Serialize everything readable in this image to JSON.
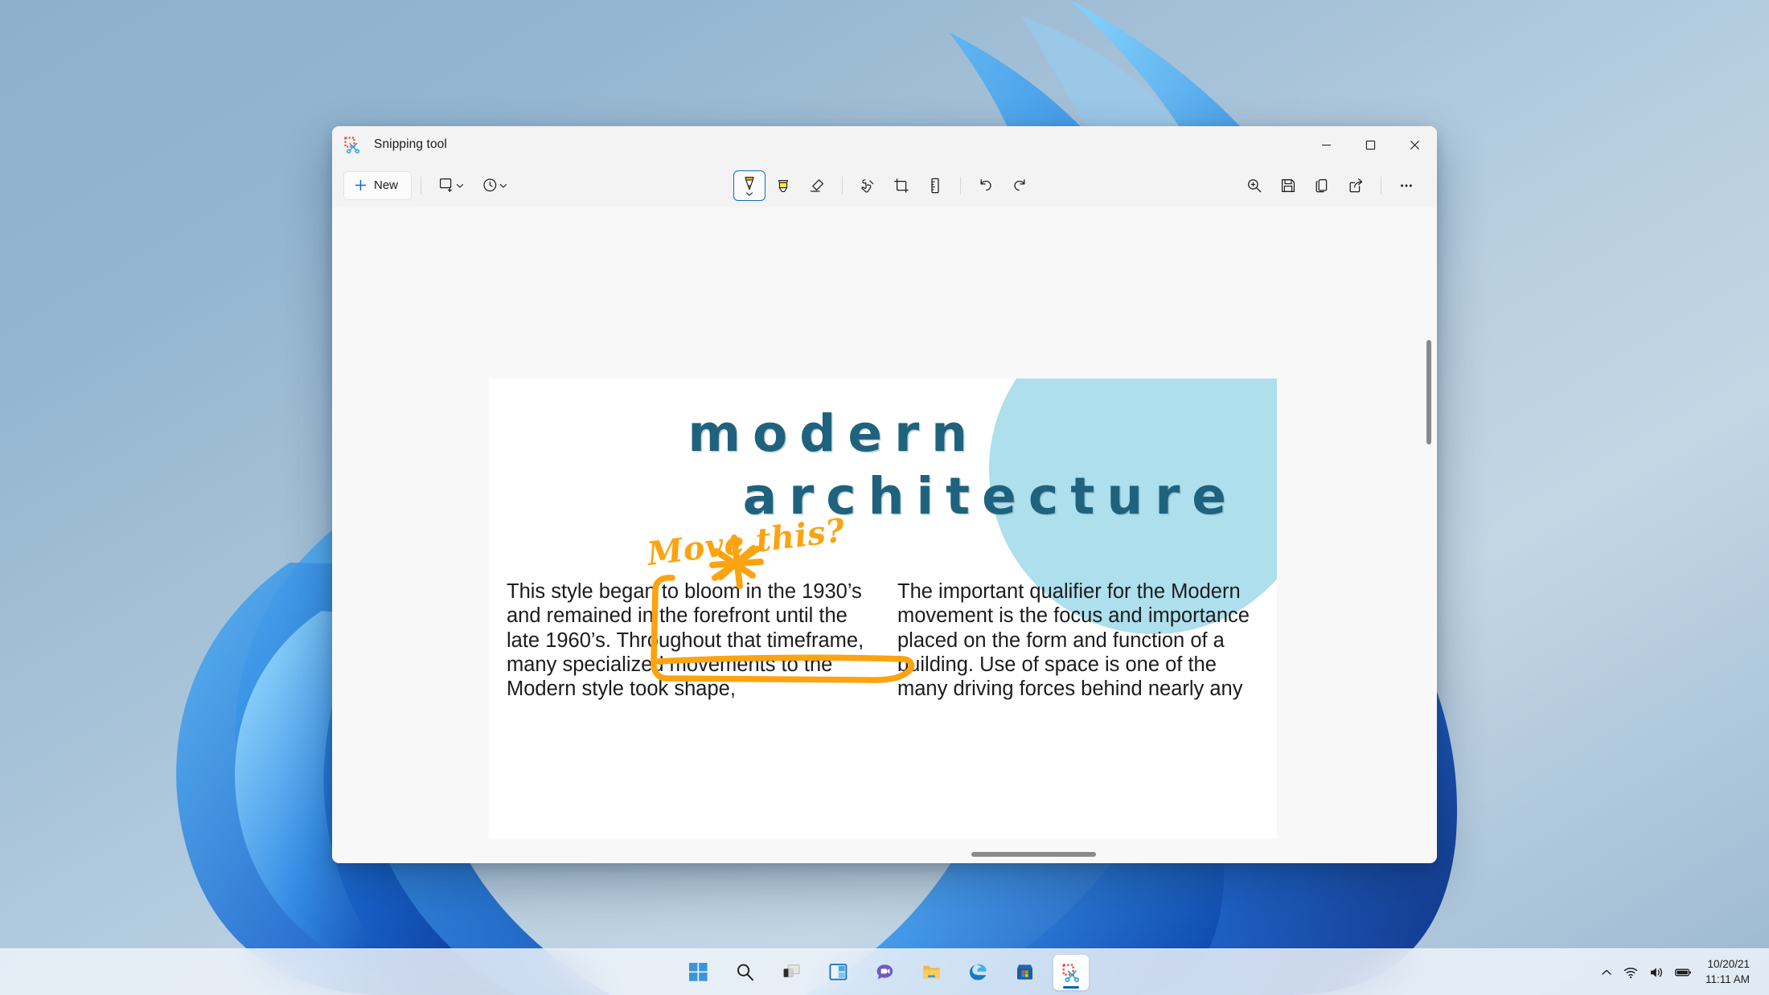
{
  "window": {
    "title": "Snipping tool",
    "app_icon": "snipping-tool-icon",
    "controls": {
      "minimize": "minimize-icon",
      "maximize": "maximize-icon",
      "close": "close-icon"
    }
  },
  "toolbar": {
    "new_label": "New",
    "left_tools": [
      {
        "name": "snip-mode-dropdown",
        "icon": "rectangle-snip-icon"
      },
      {
        "name": "delay-dropdown",
        "icon": "clock-icon"
      }
    ],
    "center_tools": [
      {
        "name": "ballpoint-pen",
        "icon": "pen-icon",
        "selected": true
      },
      {
        "name": "highlighter",
        "icon": "highlighter-icon",
        "selected": false
      },
      {
        "name": "eraser",
        "icon": "eraser-icon",
        "selected": false
      },
      {
        "name": "touch-writing",
        "icon": "touch-writing-icon",
        "selected": false
      },
      {
        "name": "crop",
        "icon": "crop-icon",
        "selected": false
      },
      {
        "name": "ruler",
        "icon": "ruler-icon",
        "selected": false
      },
      {
        "name": "undo",
        "icon": "undo-icon",
        "selected": false
      },
      {
        "name": "redo",
        "icon": "redo-icon",
        "selected": false
      }
    ],
    "right_tools": [
      {
        "name": "zoom",
        "icon": "zoom-in-icon"
      },
      {
        "name": "save",
        "icon": "save-icon"
      },
      {
        "name": "copy",
        "icon": "copy-icon"
      },
      {
        "name": "share",
        "icon": "share-icon"
      },
      {
        "name": "more-options",
        "icon": "ellipsis-icon"
      }
    ]
  },
  "document": {
    "heading_line1": "modern",
    "heading_line2": "architecture",
    "heading_color": "#1f627d",
    "circle_color": "#addfed",
    "left_column": "This style began to bloom in the 1930’s and remained in the forefront until the late 1960’s. Throughout that timeframe, many specialized movements to the Modern style took shape,",
    "right_column": "The important qualifier for the Modern movement is the focus and importance placed on the form and function of a building. Use of space is one of the many driving forces behind nearly any",
    "annotation": {
      "text": "Move this?",
      "color": "#fca311",
      "marks": [
        "asterisk-star-mark",
        "bracket-mark",
        "underline-mark"
      ]
    }
  },
  "taskbar": {
    "apps": [
      {
        "name": "start-button",
        "icon": "windows-logo-icon",
        "active": false
      },
      {
        "name": "search-button",
        "icon": "search-icon",
        "active": false
      },
      {
        "name": "task-view-button",
        "icon": "task-view-icon",
        "active": false
      },
      {
        "name": "widgets-button",
        "icon": "widgets-icon",
        "active": false
      },
      {
        "name": "chat-button",
        "icon": "chat-icon",
        "active": false
      },
      {
        "name": "file-explorer-button",
        "icon": "folder-icon",
        "active": false
      },
      {
        "name": "edge-button",
        "icon": "edge-icon",
        "active": false
      },
      {
        "name": "microsoft-store-button",
        "icon": "store-icon",
        "active": false
      },
      {
        "name": "snipping-tool-button",
        "icon": "snipping-tool-icon",
        "active": true
      }
    ],
    "tray": {
      "show_hidden": "chevron-up-icon",
      "network": "wifi-icon",
      "volume": "speaker-icon",
      "battery": "battery-icon",
      "date": "10/20/21",
      "time": "11:11 AM"
    }
  }
}
